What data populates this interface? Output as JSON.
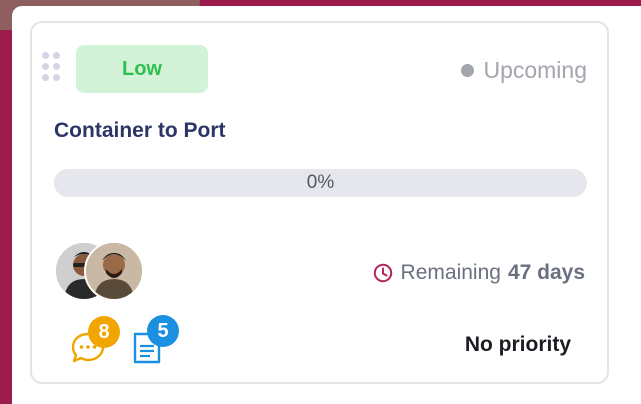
{
  "card": {
    "priority_label": "Low",
    "status_label": "Upcoming",
    "title": "Container to Port",
    "progress": {
      "percent": 0,
      "label": "0%"
    },
    "remaining": {
      "prefix": "Remaining",
      "value": "47 days"
    },
    "comments": {
      "count": "8",
      "icon": "comment-icon"
    },
    "documents": {
      "count": "5",
      "icon": "document-icon"
    },
    "priority_text": "No priority",
    "assignees": [
      {
        "icon": "avatar-1"
      },
      {
        "icon": "avatar-2"
      }
    ],
    "colors": {
      "priority_bg": "#d3f3d8",
      "priority_fg": "#2fbf4f",
      "comment_badge": "#f0a500",
      "document_badge": "#1b8fe0",
      "clock": "#b5235c"
    }
  }
}
